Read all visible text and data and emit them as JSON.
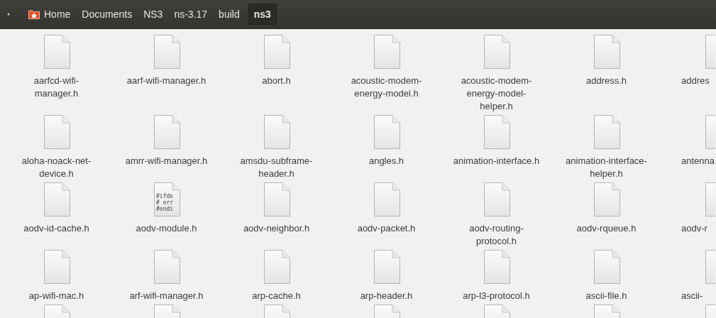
{
  "breadcrumb": [
    {
      "label": "Home",
      "kind": "home",
      "selected": false
    },
    {
      "label": "Documents",
      "kind": "folder",
      "selected": false
    },
    {
      "label": "NS3",
      "kind": "folder",
      "selected": false
    },
    {
      "label": "ns-3.17",
      "kind": "folder",
      "selected": false
    },
    {
      "label": "build",
      "kind": "folder",
      "selected": false
    },
    {
      "label": "ns3",
      "kind": "folder",
      "selected": true
    }
  ],
  "rows": [
    {
      "files": [
        {
          "name": "aarfcd-wifi-manager.h",
          "kind": "file"
        },
        {
          "name": "aarf-wifi-manager.h",
          "kind": "file"
        },
        {
          "name": "abort.h",
          "kind": "file"
        },
        {
          "name": "acoustic-modem-energy-model.h",
          "kind": "file"
        },
        {
          "name": "acoustic-modem-energy-model-helper.h",
          "kind": "file"
        },
        {
          "name": "address.h",
          "kind": "file"
        },
        {
          "name": "addres",
          "kind": "file"
        }
      ]
    },
    {
      "files": [
        {
          "name": "aloha-noack-net-device.h",
          "kind": "file"
        },
        {
          "name": "amrr-wifi-manager.h",
          "kind": "file"
        },
        {
          "name": "amsdu-subframe-header.h",
          "kind": "file"
        },
        {
          "name": "angles.h",
          "kind": "file"
        },
        {
          "name": "animation-interface.h",
          "kind": "file"
        },
        {
          "name": "animation-interface-helper.h",
          "kind": "file"
        },
        {
          "name": "antenna",
          "kind": "file"
        }
      ]
    },
    {
      "files": [
        {
          "name": "aodv-id-cache.h",
          "kind": "file"
        },
        {
          "name": "aodv-module.h",
          "kind": "source",
          "preview": [
            "#ifde",
            "# err",
            "#endi"
          ]
        },
        {
          "name": "aodv-neighbor.h",
          "kind": "file"
        },
        {
          "name": "aodv-packet.h",
          "kind": "file"
        },
        {
          "name": "aodv-routing-protocol.h",
          "kind": "file"
        },
        {
          "name": "aodv-rqueue.h",
          "kind": "file"
        },
        {
          "name": "aodv-r",
          "kind": "file"
        }
      ]
    },
    {
      "files": [
        {
          "name": "ap-wifi-mac.h",
          "kind": "file"
        },
        {
          "name": "arf-wifi-manager.h",
          "kind": "file"
        },
        {
          "name": "arp-cache.h",
          "kind": "file"
        },
        {
          "name": "arp-header.h",
          "kind": "file"
        },
        {
          "name": "arp-l3-protocol.h",
          "kind": "file"
        },
        {
          "name": "ascii-file.h",
          "kind": "file"
        },
        {
          "name": "ascii-",
          "kind": "file"
        }
      ]
    },
    {
      "files": [
        {
          "kind": "file"
        },
        {
          "kind": "file"
        },
        {
          "kind": "file"
        },
        {
          "kind": "file"
        },
        {
          "kind": "file"
        },
        {
          "kind": "file"
        },
        {
          "kind": "file"
        }
      ]
    }
  ]
}
